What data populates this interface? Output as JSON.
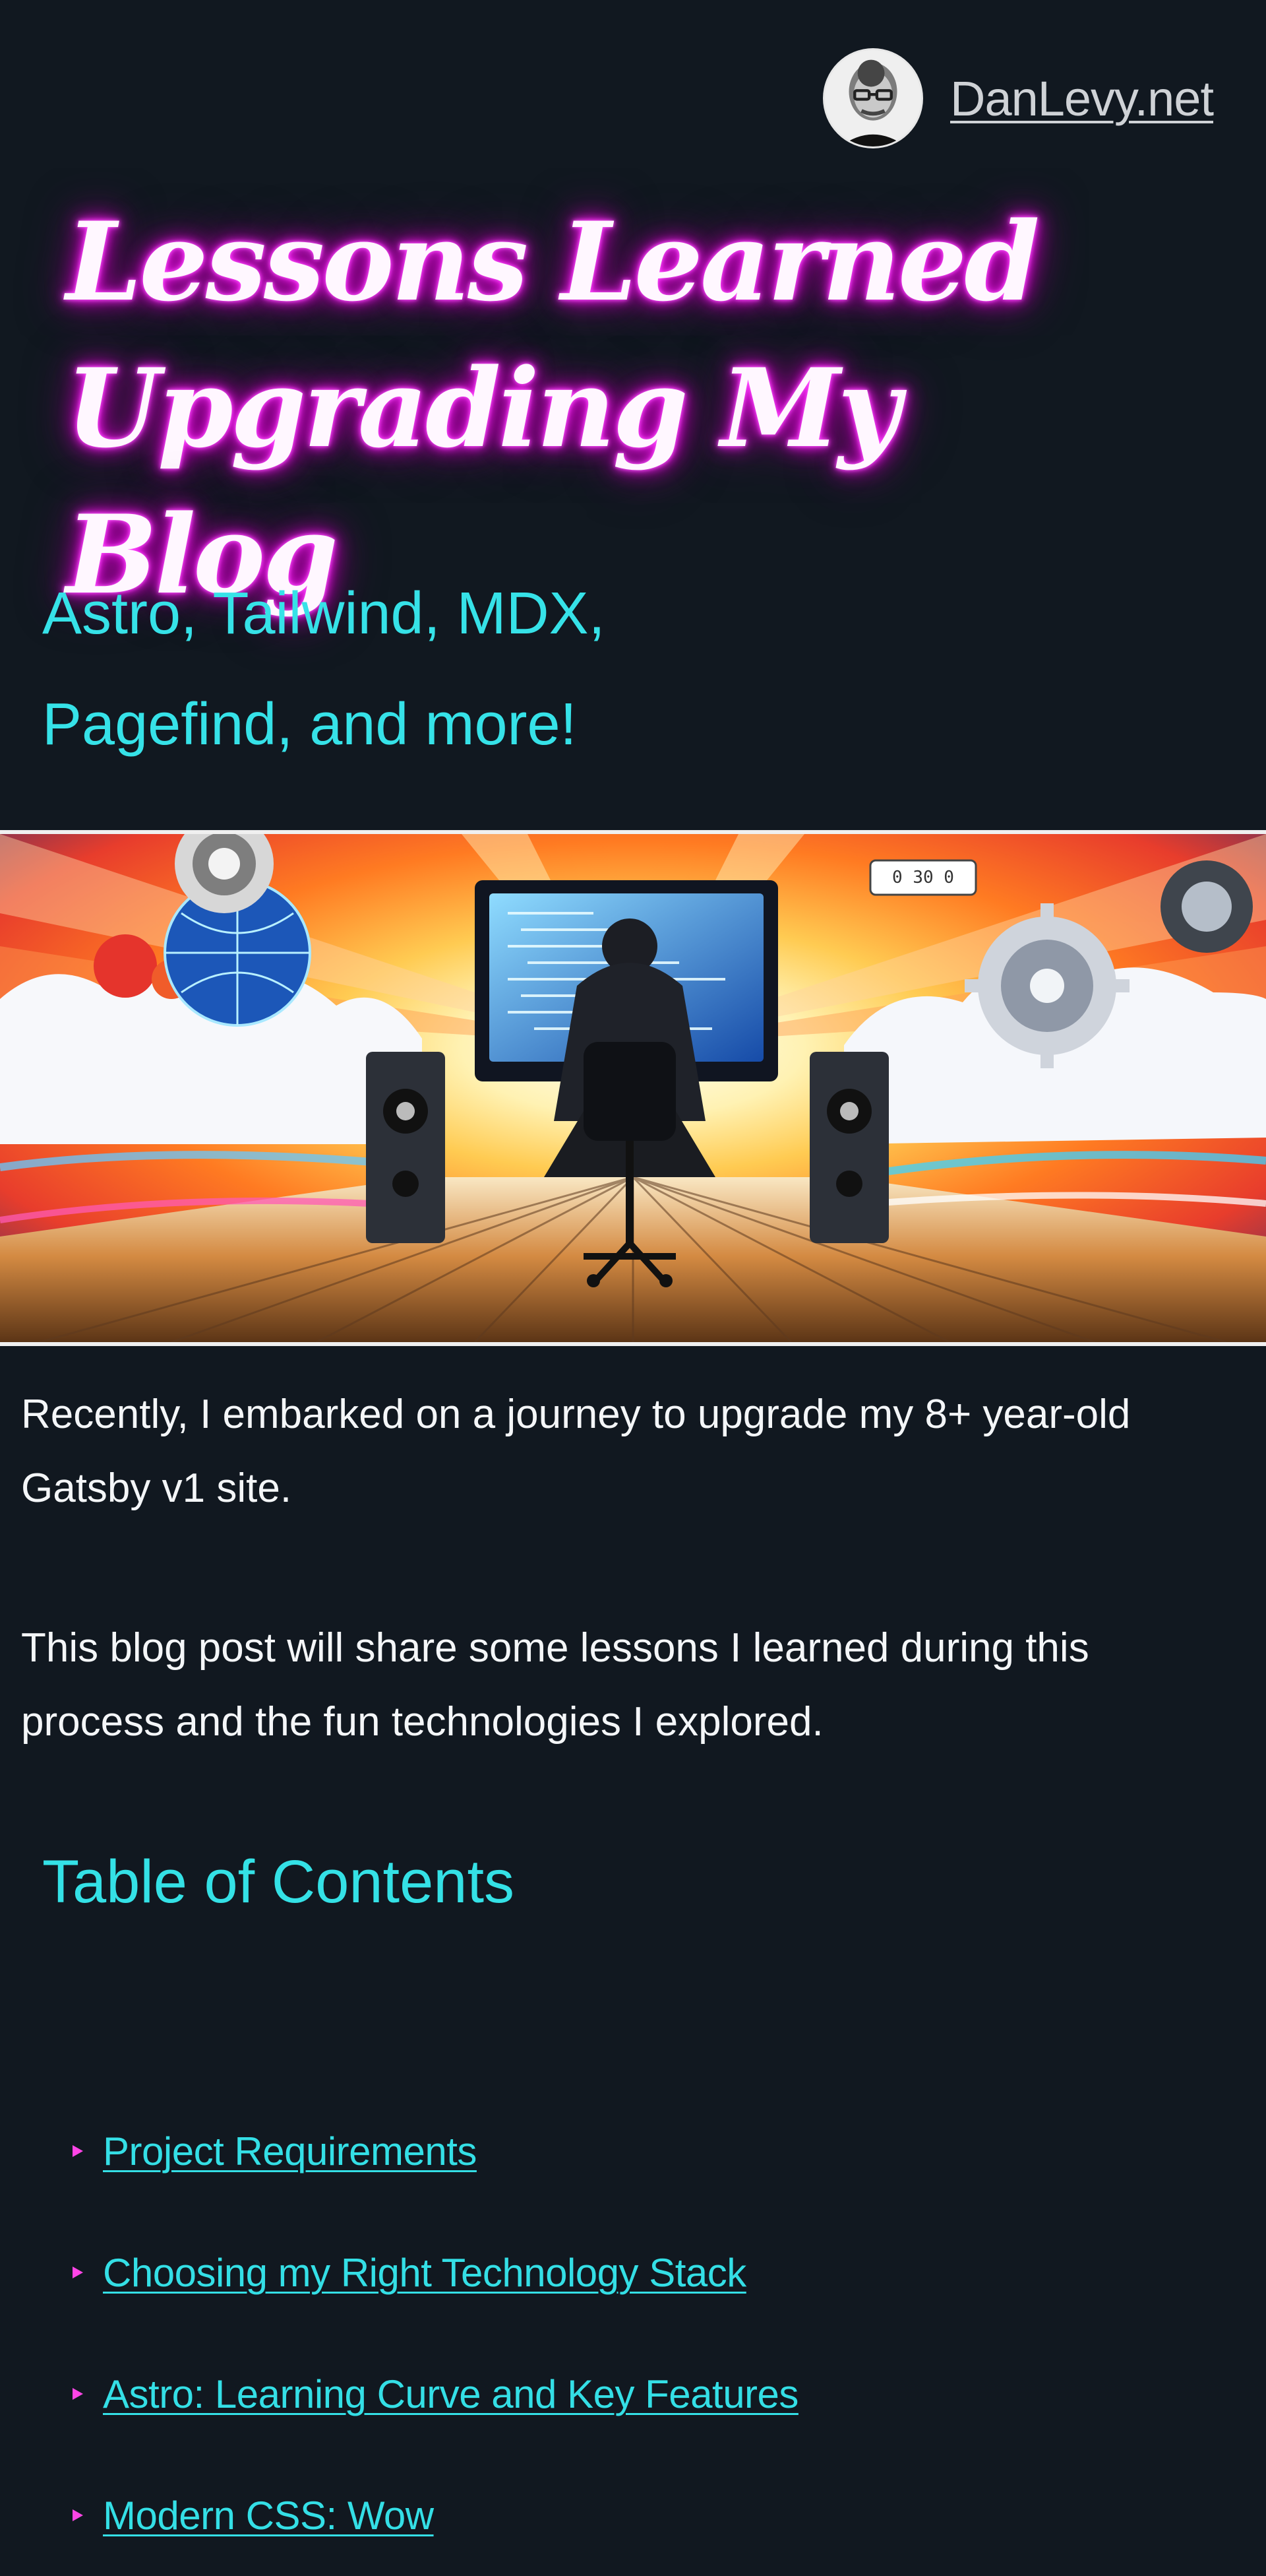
{
  "header": {
    "site_name": "DanLevy.net",
    "avatar_icon": "avatar-photo"
  },
  "hero": {
    "title_line_1": "Lessons Learned",
    "title_line_2": "Upgrading My Blog",
    "subtitle_line_1": "Astro, Tailwind, MDX,",
    "subtitle_line_2": "Pagefind, and more!"
  },
  "banner": {
    "image_name": "coding-setup-illustration"
  },
  "article": {
    "paragraphs": [
      "Recently, I embarked on a journey to upgrade my 8+ year-old Gatsby v1 site.",
      "This blog post will share some lessons I learned during this process and the fun technologies I explored."
    ]
  },
  "toc": {
    "title": "Table of Contents",
    "items": [
      {
        "label": "Project Requirements"
      },
      {
        "label": "Choosing my Right Technology Stack"
      },
      {
        "label": "Astro: Learning Curve and Key Features"
      },
      {
        "label": "Modern CSS: Wow"
      }
    ]
  },
  "colors": {
    "background": "#111820",
    "accent_cyan": "#34e1e6",
    "accent_magenta": "#ff45e6",
    "text": "#f4f6f8"
  }
}
